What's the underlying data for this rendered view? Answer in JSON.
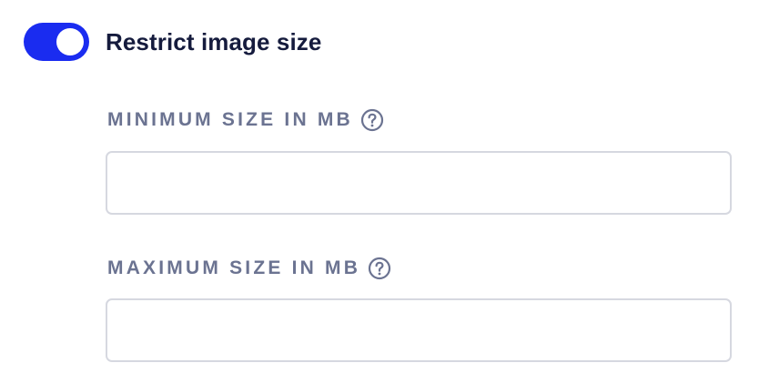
{
  "restrict": {
    "label": "Restrict image size",
    "enabled": true,
    "accent_color": "#1a2cf0"
  },
  "fields": [
    {
      "label": "MINIMUM SIZE IN MB",
      "value": "",
      "placeholder": "",
      "help_icon": "question-circle-icon"
    },
    {
      "label": "MAXIMUM SIZE IN MB",
      "value": "",
      "placeholder": "",
      "help_icon": "question-circle-icon"
    }
  ]
}
